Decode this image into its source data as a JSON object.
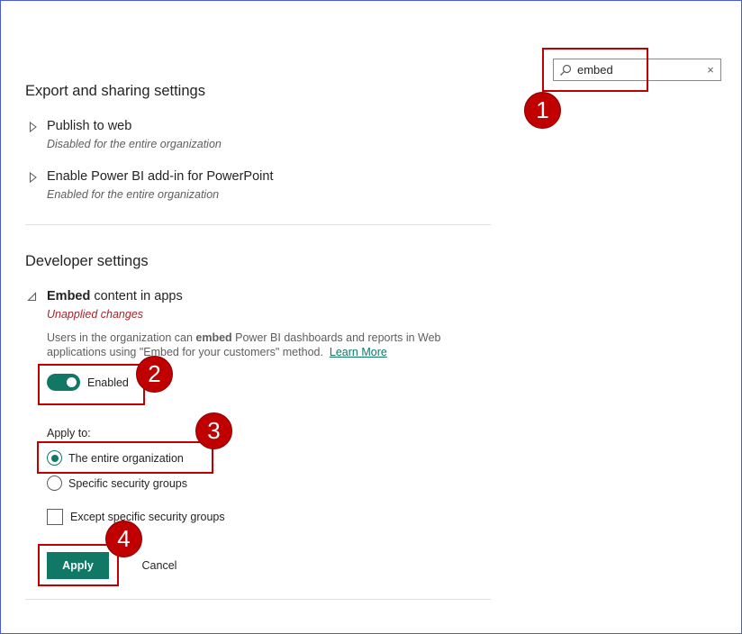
{
  "search": {
    "value": "embed",
    "icon": "search-icon",
    "clear_glyph": "×"
  },
  "export_section": {
    "title": "Export and sharing settings",
    "items": [
      {
        "title": "Publish to web",
        "status": "Disabled for the entire organization"
      },
      {
        "title": "Enable Power BI add-in for PowerPoint",
        "status": "Enabled for the entire organization"
      }
    ]
  },
  "developer_section": {
    "title": "Developer settings",
    "setting": {
      "title_bold": "Embed",
      "title_rest": " content in apps",
      "state": "Unapplied changes",
      "desc_part1": "Users in the organization can ",
      "desc_bold": "embed",
      "desc_part2": " Power BI dashboards and reports in Web applications using \"Embed for your customers\" method.",
      "learn_more": "Learn More",
      "toggle_label": "Enabled",
      "toggle_on": true,
      "apply_to_label": "Apply to:",
      "radio_options": [
        "The entire organization",
        "Specific security groups"
      ],
      "selected_option": "The entire organization",
      "except_label": "Except specific security groups",
      "except_checked": false
    }
  },
  "buttons": {
    "apply": "Apply",
    "cancel": "Cancel"
  },
  "annotations": [
    "1",
    "2",
    "3",
    "4"
  ],
  "colors": {
    "accent": "#117865",
    "highlight": "#c00000",
    "warning_text": "#a4262c"
  }
}
